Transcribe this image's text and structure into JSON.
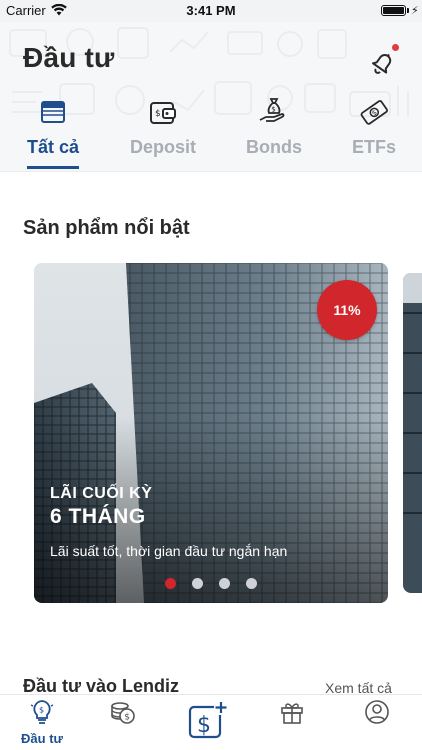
{
  "status_bar": {
    "carrier": "Carrier",
    "time": "3:41 PM"
  },
  "header": {
    "title": "Đầu tư",
    "tabs": [
      {
        "label": "Tất cả",
        "icon": "stack-icon",
        "active": true
      },
      {
        "label": "Deposit",
        "icon": "wallet-icon",
        "active": false
      },
      {
        "label": "Bonds",
        "icon": "money-bag-hand-icon",
        "active": false
      },
      {
        "label": "ETFs",
        "icon": "banknote-icon",
        "active": false
      }
    ],
    "notification_badge": true
  },
  "featured": {
    "title": "Sản phẩm nổi bật",
    "card": {
      "rate": "11%",
      "kicker": "LÃI CUỐI KỲ",
      "heading": "6 THÁNG",
      "description": "Lãi suất tốt, thời gian đầu tư ngắn hạn"
    },
    "pagination": {
      "count": 4,
      "active": 1
    }
  },
  "lendiz": {
    "title": "Đầu tư vào Lendiz",
    "see_all": "Xem tất cả"
  },
  "bottom_nav": {
    "items": [
      {
        "label": "Đầu tư",
        "icon": "investment-bulb-icon",
        "active": true
      },
      {
        "label": "",
        "icon": "coins-icon",
        "active": false
      },
      {
        "label": "",
        "icon": "add-invest-icon",
        "active": false
      },
      {
        "label": "",
        "icon": "gift-icon",
        "active": false
      },
      {
        "label": "",
        "icon": "profile-icon",
        "active": false
      }
    ]
  },
  "colors": {
    "accent": "#1e4e8c",
    "badge": "#d0262c",
    "inactive": "#a9aeb5"
  }
}
